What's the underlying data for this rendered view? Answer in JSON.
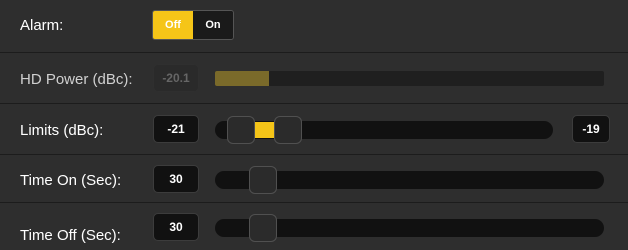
{
  "alarm": {
    "label": "Alarm:",
    "options": [
      "Off",
      "On"
    ],
    "selected": "Off"
  },
  "hd_power": {
    "label": "HD Power (dBc):",
    "value": "-20.1",
    "meter_level": 0.14,
    "meter_color": "#7a6a2a"
  },
  "limits": {
    "label": "Limits (dBc):",
    "low_value": "-21",
    "high_value": "-19"
  },
  "time_on": {
    "label": "Time On (Sec):",
    "value": "30"
  },
  "time_off": {
    "label": "Time Off (Sec):",
    "value": "30"
  },
  "colors": {
    "accent": "#f5c518",
    "background": "#1c1c1c",
    "row": "#2e2e2e"
  }
}
